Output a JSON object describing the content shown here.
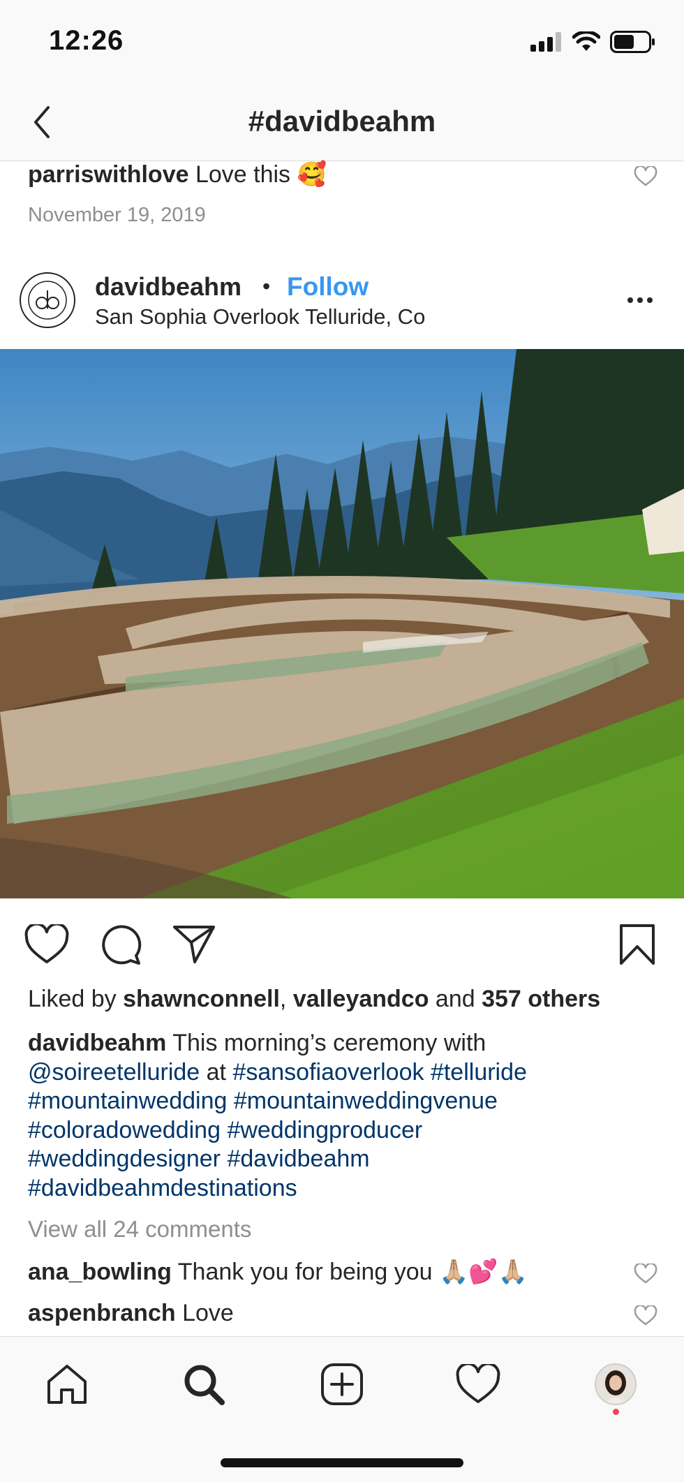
{
  "status_bar": {
    "time": "12:26"
  },
  "header": {
    "title": "#davidbeahm"
  },
  "prev_comment": {
    "username": "parriswithlove",
    "text": "Love this 🥰",
    "date": "November 19, 2019"
  },
  "post": {
    "username": "davidbeahm",
    "separator": "•",
    "follow_label": "Follow",
    "location": "San Sophia Overlook Telluride, Co",
    "likes": {
      "prefix": "Liked by ",
      "user1": "shawnconnell",
      "sep": ", ",
      "user2": "valleyandco",
      "mid": " and ",
      "others": "357 others"
    },
    "caption": {
      "username": "davidbeahm",
      "text": " This morning’s ceremony with ",
      "mention": "@soireetelluride",
      "at": " at ",
      "tags": [
        "#sansofiaoverlook",
        "#telluride",
        "#mountainwedding",
        "#mountainweddingvenue",
        "#coloradowedding",
        "#weddingproducer",
        "#weddingdesigner",
        "#davidbeahm",
        "#davidbeahmdestinations"
      ]
    },
    "view_all": "View all 24 comments",
    "comments": [
      {
        "username": "ana_bowling",
        "text": "Thank you for being you 🙏🏼💕🙏🏼"
      },
      {
        "username": "aspenbranch",
        "text": "Love"
      }
    ]
  },
  "icons": {
    "back": "chevron-left-icon",
    "like": "heart-icon",
    "comment": "comment-icon",
    "share": "paper-plane-icon",
    "save": "bookmark-icon",
    "tabs": [
      "home-icon",
      "search-icon",
      "new-post-icon",
      "activity-heart-icon",
      "profile-avatar"
    ]
  },
  "colors": {
    "link": "#3897f0",
    "hashtag": "#003569",
    "muted": "#8e8e8e",
    "notification": "#ed4956"
  }
}
